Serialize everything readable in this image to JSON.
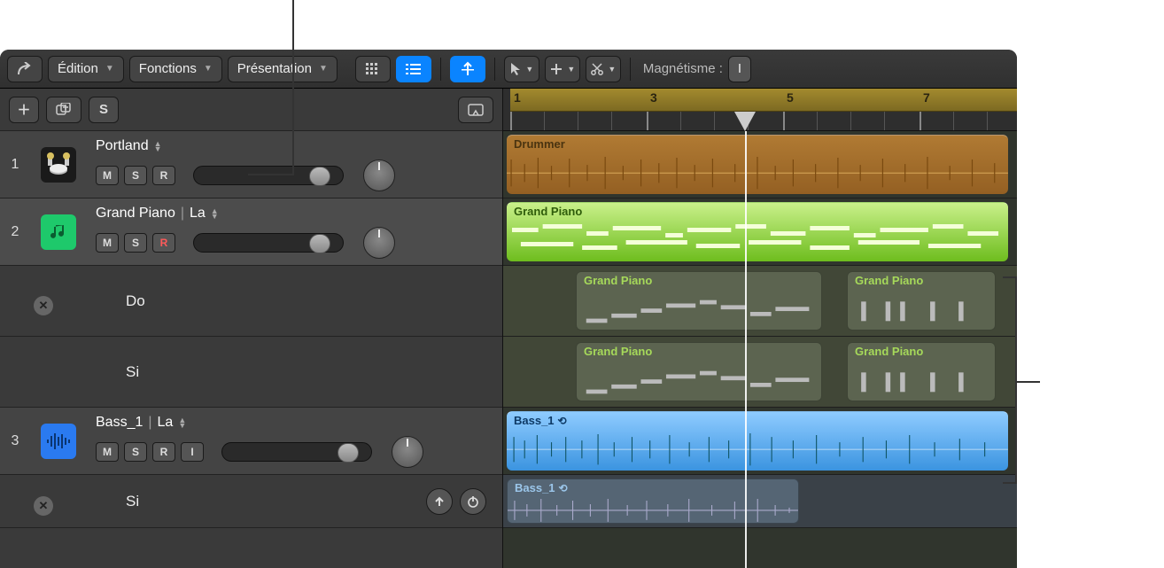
{
  "topbar": {
    "menus": {
      "edition": "Édition",
      "fonctions": "Fonctions",
      "presentation": "Présentation"
    },
    "snap_label": "Magnétisme :",
    "snap_value": "I"
  },
  "ruler": {
    "marks": [
      "1",
      "3",
      "5",
      "7"
    ]
  },
  "tracks": [
    {
      "num": "1",
      "name": "Portland",
      "buttons": [
        "M",
        "S",
        "R"
      ],
      "type": "drummer"
    },
    {
      "num": "2",
      "name": "Grand Piano",
      "take": "La",
      "buttons": [
        "M",
        "S",
        "R"
      ],
      "type": "midi",
      "subs": [
        {
          "label": "Do"
        },
        {
          "label": "Si"
        }
      ]
    },
    {
      "num": "3",
      "name": "Bass_1",
      "take": "La",
      "buttons": [
        "M",
        "S",
        "R",
        "I"
      ],
      "type": "audio",
      "subs": [
        {
          "label": "Si"
        }
      ]
    }
  ],
  "regions": {
    "drummer": "Drummer",
    "piano_main": "Grand Piano",
    "piano_sub": "Grand Piano",
    "bass_main": "Bass_1",
    "bass_sub": "Bass_1"
  }
}
